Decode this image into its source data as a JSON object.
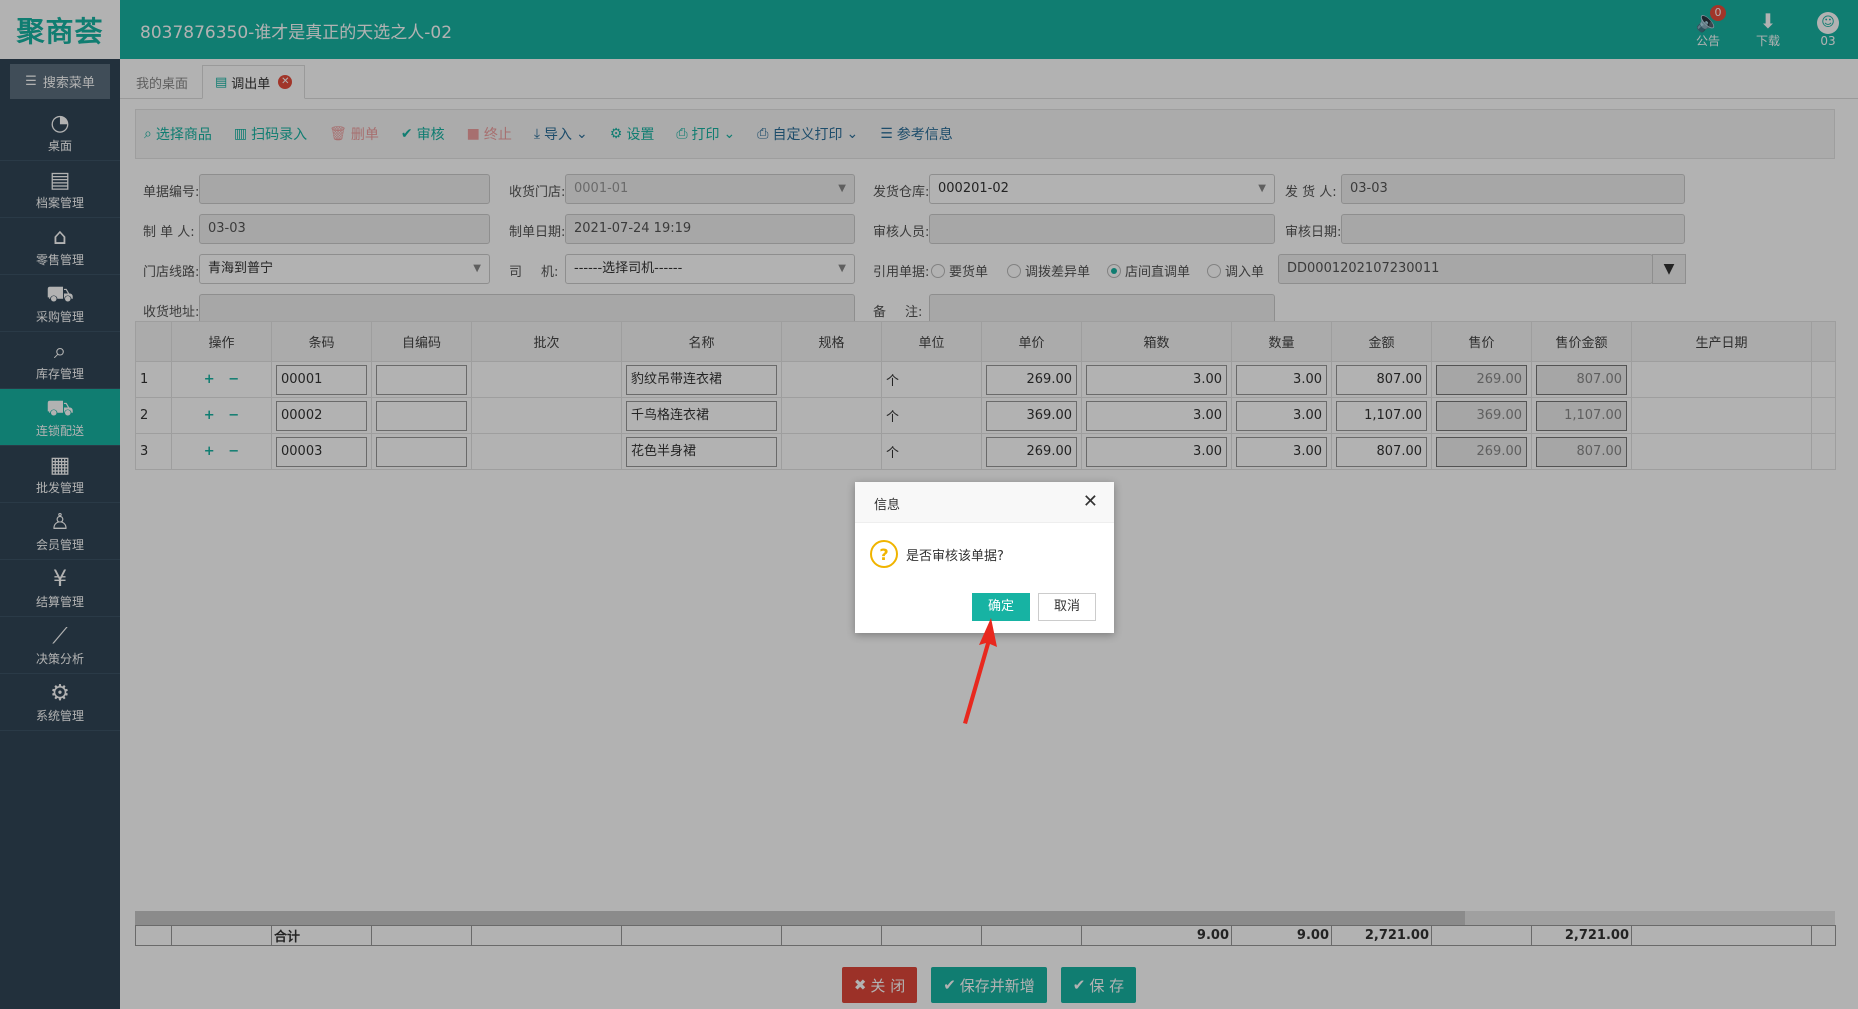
{
  "header": {
    "logo": "聚商荟",
    "title": "8037876350-谁才是真正的天选之人-02",
    "actions": [
      {
        "label": "公告",
        "icon": "speaker-icon",
        "badge": "0"
      },
      {
        "label": "下载",
        "icon": "download-icon"
      },
      {
        "label": "03",
        "icon": "avatar-icon"
      }
    ]
  },
  "sidebar": {
    "search": "搜索菜单",
    "items": [
      {
        "label": "桌面",
        "icon": "dashboard-icon"
      },
      {
        "label": "档案管理",
        "icon": "archive-icon"
      },
      {
        "label": "零售管理",
        "icon": "store-icon"
      },
      {
        "label": "采购管理",
        "icon": "cart-icon"
      },
      {
        "label": "库存管理",
        "icon": "inventory-icon"
      },
      {
        "label": "连锁配送",
        "icon": "truck-icon",
        "active": true
      },
      {
        "label": "批发管理",
        "icon": "wholesale-icon"
      },
      {
        "label": "会员管理",
        "icon": "member-icon"
      },
      {
        "label": "结算管理",
        "icon": "settlement-icon"
      },
      {
        "label": "决策分析",
        "icon": "chart-icon"
      },
      {
        "label": "系统管理",
        "icon": "settings-icon"
      }
    ]
  },
  "tabs": [
    {
      "label": "我的桌面"
    },
    {
      "label": "调出单",
      "active": true
    }
  ],
  "toolbar": {
    "select_goods": "选择商品",
    "scan_input": "扫码录入",
    "delete": "删单",
    "audit": "审核",
    "terminate": "终止",
    "import": "导入",
    "settings": "设置",
    "print": "打印",
    "custom_print": "自定义打印",
    "reference": "参考信息"
  },
  "form": {
    "doc_no_label": "单据编号:",
    "doc_no": "",
    "recv_store_label": "收货门店:",
    "recv_store": "0001-01",
    "ship_wh_label": "发货仓库:",
    "ship_wh": "000201-02",
    "shipper_label": "发 货 人:",
    "shipper": "03-03",
    "maker_label": "制 单 人:",
    "maker": "03-03",
    "make_date_label": "制单日期:",
    "make_date": "2021-07-24 19:19",
    "auditor_label": "审核人员:",
    "auditor": "",
    "audit_date_label": "审核日期:",
    "audit_date": "",
    "route_label": "门店线路:",
    "route": "青海到普宁",
    "driver_label_a": "司",
    "driver_label_b": "机:",
    "driver": "------选择司机------",
    "ref_doc_label": "引用单据:",
    "ref_options": [
      "要货单",
      "调拨差异单",
      "店间直调单",
      "调入单"
    ],
    "ref_selected": 2,
    "ref_doc_no": "DD0001202107230011",
    "address_label": "收货地址:",
    "address": "",
    "remark_label_a": "备",
    "remark_label_b": "注:",
    "remark": ""
  },
  "table": {
    "columns": [
      "",
      "操作",
      "条码",
      "自编码",
      "批次",
      "名称",
      "规格",
      "单位",
      "单价",
      "箱数",
      "数量",
      "金额",
      "售价",
      "售价金额",
      "生产日期"
    ],
    "rows": [
      {
        "no": "1",
        "barcode": "00001",
        "code": "",
        "batch": "",
        "name": "豹纹吊带连衣裙",
        "spec": "",
        "unit": "个",
        "price": "269.00",
        "boxes": "3.00",
        "qty": "3.00",
        "amount": "807.00",
        "sale_price": "269.00",
        "sale_amount": "807.00",
        "mfg_date": ""
      },
      {
        "no": "2",
        "barcode": "00002",
        "code": "",
        "batch": "",
        "name": "千鸟格连衣裙",
        "spec": "",
        "unit": "个",
        "price": "369.00",
        "boxes": "3.00",
        "qty": "3.00",
        "amount": "1,107.00",
        "sale_price": "369.00",
        "sale_amount": "1,107.00",
        "mfg_date": ""
      },
      {
        "no": "3",
        "barcode": "00003",
        "code": "",
        "batch": "",
        "name": "花色半身裙",
        "spec": "",
        "unit": "个",
        "price": "269.00",
        "boxes": "3.00",
        "qty": "3.00",
        "amount": "807.00",
        "sale_price": "269.00",
        "sale_amount": "807.00",
        "mfg_date": ""
      }
    ],
    "totals": {
      "label": "合计",
      "boxes": "9.00",
      "qty": "9.00",
      "amount": "2,721.00",
      "sale_amount": "2,721.00"
    }
  },
  "footer": {
    "close": "关 闭",
    "save_new": "保存并新增",
    "save": "保 存"
  },
  "dialog": {
    "title": "信息",
    "message": "是否审核该单据?",
    "confirm": "确定",
    "cancel": "取消"
  },
  "colors": {
    "accent": "#17b3a3",
    "sidebar": "#314657",
    "danger": "#e0473a",
    "arrow": "#e8281e"
  }
}
